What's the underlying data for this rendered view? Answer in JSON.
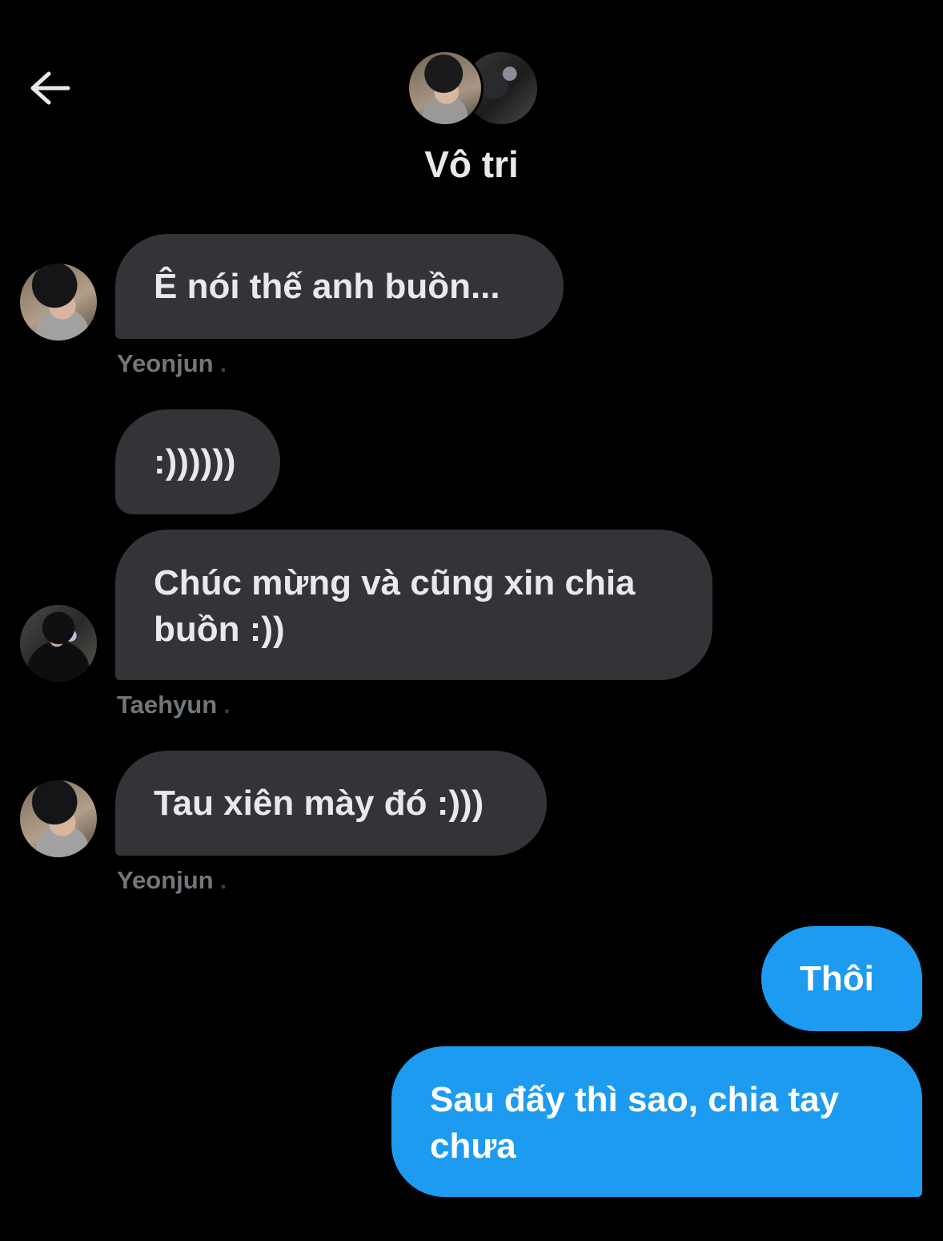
{
  "header": {
    "back_icon": "arrow-left-icon",
    "title": "Vô tri"
  },
  "colors": {
    "background": "#000000",
    "incoming_bubble": "#323438",
    "outgoing_bubble": "#1d9bf0",
    "sender_name": "#71767b"
  },
  "messages": [
    {
      "direction": "incoming",
      "text": "Ê nói thế anh buồn...",
      "sender": "Yeonjun"
    },
    {
      "direction": "incoming",
      "text": ":))))))"
    },
    {
      "direction": "incoming",
      "text": "Chúc mừng và cũng xin chia buồn :))",
      "sender": "Taehyun"
    },
    {
      "direction": "incoming",
      "text": "Tau xiên mày đó :)))",
      "sender": "Yeonjun"
    },
    {
      "direction": "outgoing",
      "text": "Thôi"
    },
    {
      "direction": "outgoing",
      "text": "Sau đấy thì sao, chia tay chưa"
    }
  ],
  "sender_separator": "."
}
